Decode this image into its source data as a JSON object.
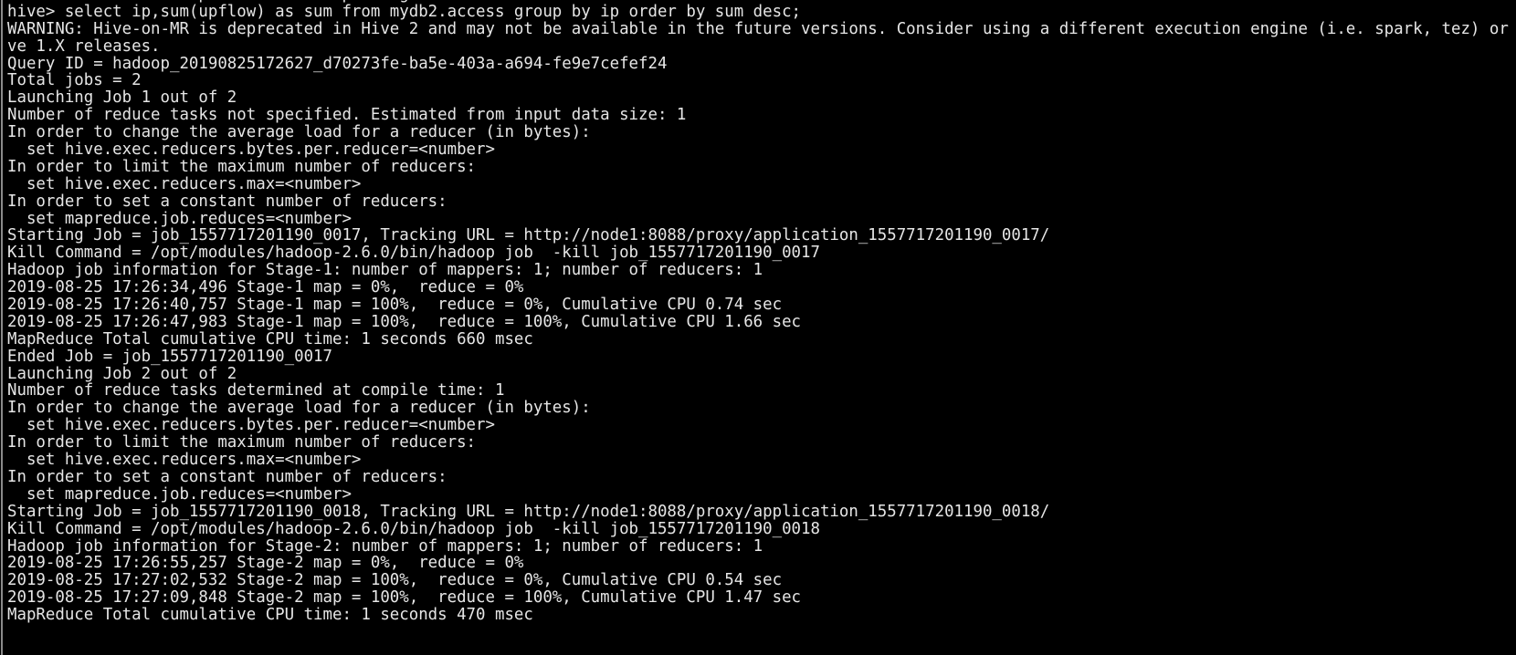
{
  "terminal": {
    "colors": {
      "background": "#000000",
      "foreground": "#e6e6e6"
    },
    "lines": [
      "FAILED: SemanticException Error in parsing",
      "hive> select ip,sum(upflow) as sum from mydb2.access group by ip order by sum desc;",
      "WARNING: Hive-on-MR is deprecated in Hive 2 and may not be available in the future versions. Consider using a different execution engine (i.e. spark, tez) or using Hi",
      "ve 1.X releases.",
      "Query ID = hadoop_20190825172627_d70273fe-ba5e-403a-a694-fe9e7cefef24",
      "Total jobs = 2",
      "Launching Job 1 out of 2",
      "Number of reduce tasks not specified. Estimated from input data size: 1",
      "In order to change the average load for a reducer (in bytes):",
      "  set hive.exec.reducers.bytes.per.reducer=<number>",
      "In order to limit the maximum number of reducers:",
      "  set hive.exec.reducers.max=<number>",
      "In order to set a constant number of reducers:",
      "  set mapreduce.job.reduces=<number>",
      "Starting Job = job_1557717201190_0017, Tracking URL = http://node1:8088/proxy/application_1557717201190_0017/",
      "Kill Command = /opt/modules/hadoop-2.6.0/bin/hadoop job  -kill job_1557717201190_0017",
      "Hadoop job information for Stage-1: number of mappers: 1; number of reducers: 1",
      "2019-08-25 17:26:34,496 Stage-1 map = 0%,  reduce = 0%",
      "2019-08-25 17:26:40,757 Stage-1 map = 100%,  reduce = 0%, Cumulative CPU 0.74 sec",
      "2019-08-25 17:26:47,983 Stage-1 map = 100%,  reduce = 100%, Cumulative CPU 1.66 sec",
      "MapReduce Total cumulative CPU time: 1 seconds 660 msec",
      "Ended Job = job_1557717201190_0017",
      "Launching Job 2 out of 2",
      "Number of reduce tasks determined at compile time: 1",
      "In order to change the average load for a reducer (in bytes):",
      "  set hive.exec.reducers.bytes.per.reducer=<number>",
      "In order to limit the maximum number of reducers:",
      "  set hive.exec.reducers.max=<number>",
      "In order to set a constant number of reducers:",
      "  set mapreduce.job.reduces=<number>",
      "Starting Job = job_1557717201190_0018, Tracking URL = http://node1:8088/proxy/application_1557717201190_0018/",
      "Kill Command = /opt/modules/hadoop-2.6.0/bin/hadoop job  -kill job_1557717201190_0018",
      "Hadoop job information for Stage-2: number of mappers: 1; number of reducers: 1",
      "2019-08-25 17:26:55,257 Stage-2 map = 0%,  reduce = 0%",
      "2019-08-25 17:27:02,532 Stage-2 map = 100%,  reduce = 0%, Cumulative CPU 0.54 sec",
      "2019-08-25 17:27:09,848 Stage-2 map = 100%,  reduce = 100%, Cumulative CPU 1.47 sec",
      "MapReduce Total cumulative CPU time: 1 seconds 470 msec"
    ]
  }
}
